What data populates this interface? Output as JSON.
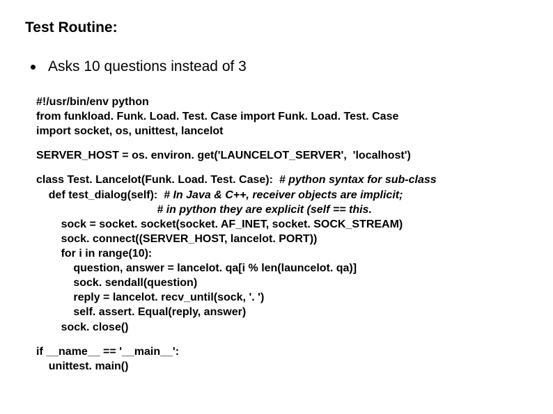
{
  "title": "Test Routine:",
  "bullet": "Asks 10 questions instead of 3",
  "code": {
    "l1": "#!/usr/bin/env python",
    "l2": "from funkload. Funk. Load. Test. Case import Funk. Load. Test. Case",
    "l3": "import socket, os, unittest, lancelot",
    "l4": "SERVER_HOST = os. environ. get('LAUNCELOT_SERVER',  'localhost')",
    "l5a": "class Test. Lancelot(Funk. Load. Test. Case):  ",
    "l5b": "# python syntax for sub-class",
    "l6a": "    def test_dialog(self):  ",
    "l6b": "# In Java & C++, receiver objects are implicit;",
    "l7": "                                       # in python they are explicit (self == this.",
    "l8": "        sock = socket. socket(socket. AF_INET, socket. SOCK_STREAM)",
    "l9": "        sock. connect((SERVER_HOST, lancelot. PORT))",
    "l10": "        for i in range(10):",
    "l11": "            question, answer = lancelot. qa[i % len(launcelot. qa)]",
    "l12": "            sock. sendall(question)",
    "l13": "            reply = lancelot. recv_until(sock, '. ')",
    "l14": "            self. assert. Equal(reply, answer)",
    "l15": "        sock. close()",
    "l16": "if __name__ == '__main__':",
    "l17": "    unittest. main()"
  }
}
